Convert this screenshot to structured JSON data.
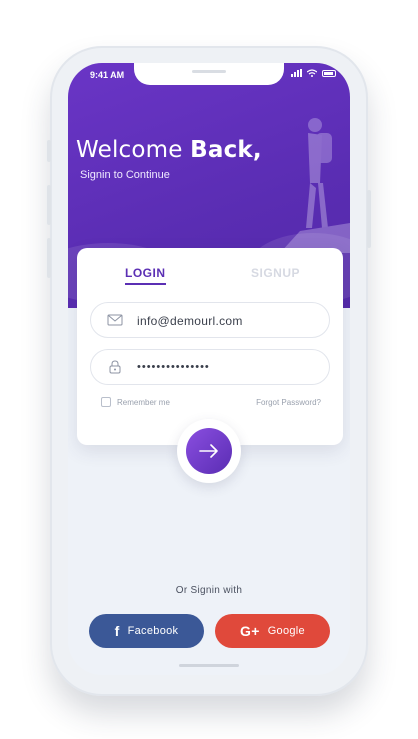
{
  "status_bar": {
    "time": "9:41 AM"
  },
  "header": {
    "welcome": "Welcome",
    "welcome_bold": "Back,",
    "subtitle": "Signin to Continue"
  },
  "tabs": [
    {
      "label": "LOGIN",
      "active": true
    },
    {
      "label": "SIGNUP",
      "active": false
    }
  ],
  "form": {
    "email_value": "info@demourl.com",
    "password_value": "•••••••••••••••",
    "remember_label": "Remember me",
    "remember_checked": false,
    "forgot_label": "Forgot Password?"
  },
  "social": {
    "prompt": "Or Signin with",
    "facebook_label": "Facebook",
    "facebook_glyph": "f",
    "google_label": "Google",
    "google_glyph": "G+"
  },
  "colors": {
    "accent": "#5b2fb4",
    "facebook": "#3b5897",
    "google": "#e0493b"
  }
}
